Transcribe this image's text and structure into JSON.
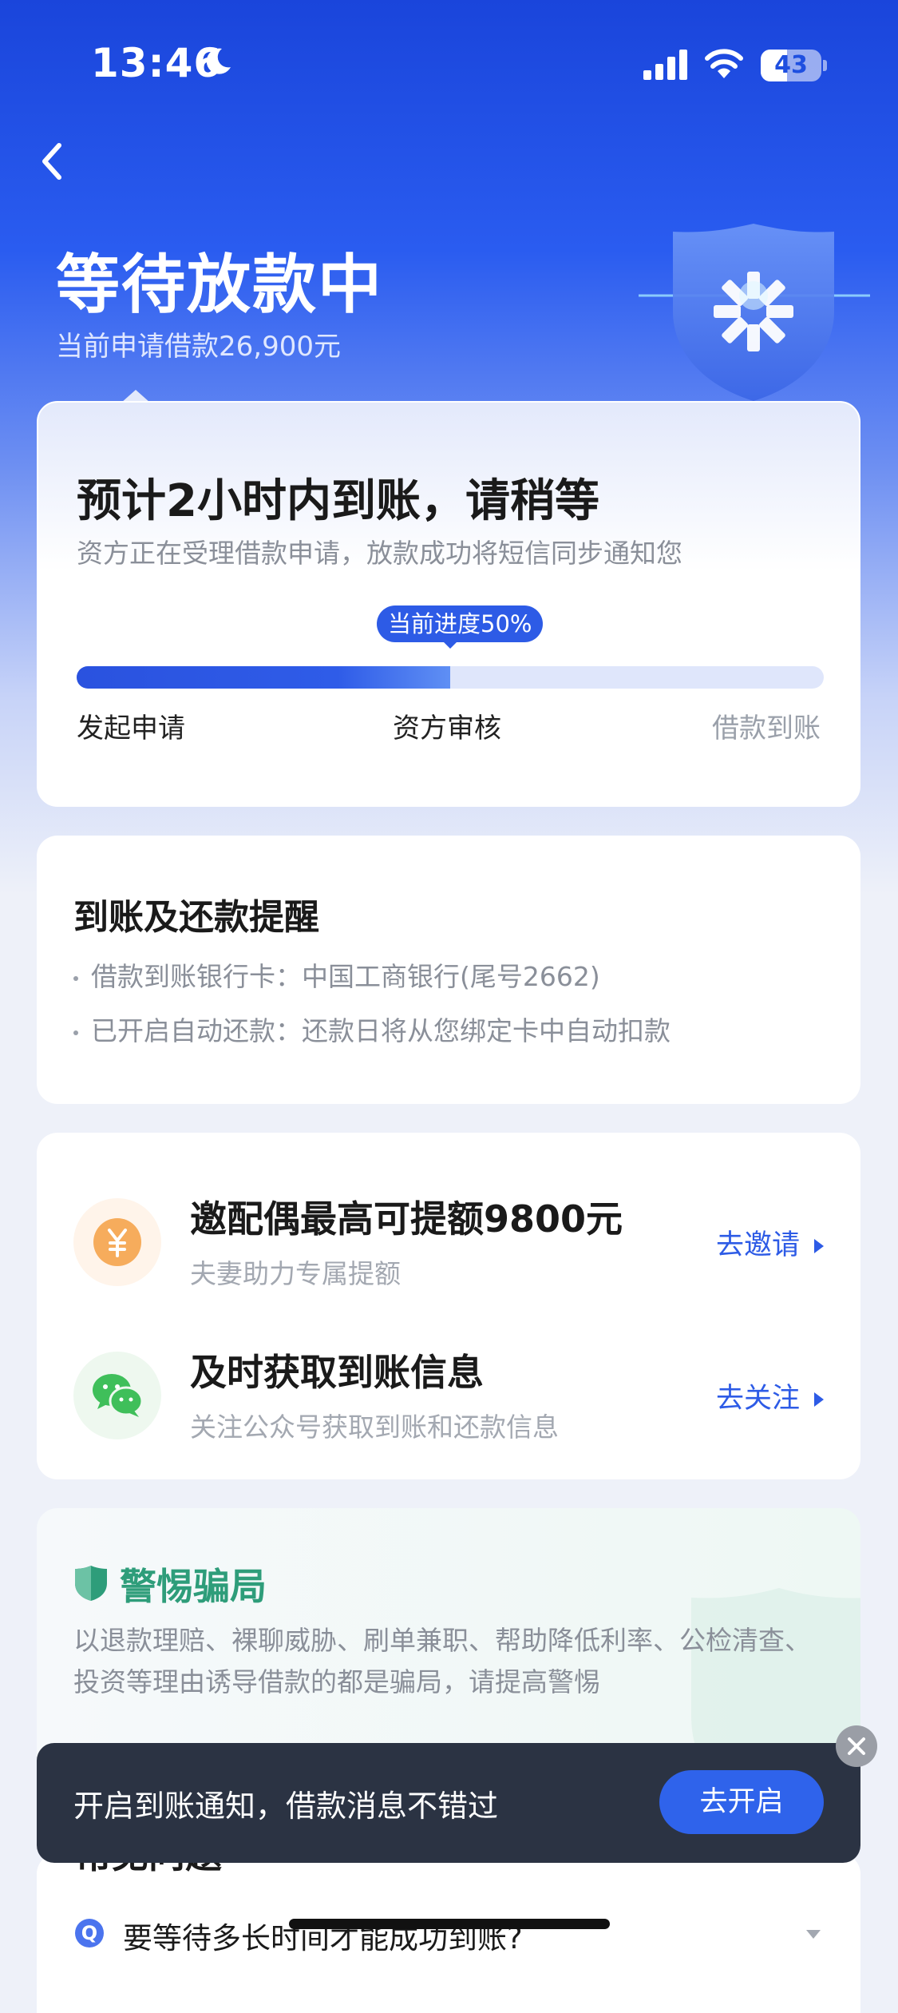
{
  "status_bar": {
    "time": "13:46",
    "battery": "43",
    "battery_level": 0.43
  },
  "header": {
    "title": "等待放款中",
    "subtitle": "当前申请借款26,900元"
  },
  "progress_card": {
    "title": "预计2小时内到账，请稍等",
    "description": "资方正在受理借款申请，放款成功将短信同步通知您",
    "badge": "当前进度50%",
    "progress": 0.5,
    "steps": [
      "发起申请",
      "资方审核",
      "借款到账"
    ]
  },
  "reminder_card": {
    "title": "到账及还款提醒",
    "lines": [
      "借款到账银行卡：中国工商银行(尾号2662)",
      "已开启自动还款：还款日将从您绑定卡中自动扣款"
    ]
  },
  "actions": [
    {
      "icon": "yen-coin-icon",
      "title": "邀配偶最高可提额9800元",
      "subtitle": "夫妻助力专属提额",
      "link": "去邀请"
    },
    {
      "icon": "wechat-icon",
      "title": "及时获取到账信息",
      "subtitle": "关注公众号获取到账和还款信息",
      "link": "去关注"
    }
  ],
  "fraud_card": {
    "title": "警惕骗局",
    "description": "以退款理赔、裸聊威胁、刷单兼职、帮助降低利率、公检清查、投资等理由诱导借款的都是骗局，请提高警惕"
  },
  "faq": {
    "title": "常见问题",
    "badge": "Q",
    "question": "要等待多长时间才能成功到账?"
  },
  "toast": {
    "text": "开启到账通知，借款消息不错过",
    "button": "去开启"
  },
  "colors": {
    "primary": "#2d5be6",
    "hero_top": "#1a45db",
    "fraud_green": "#2e9d7a",
    "toast_bg": "#2b3343"
  }
}
